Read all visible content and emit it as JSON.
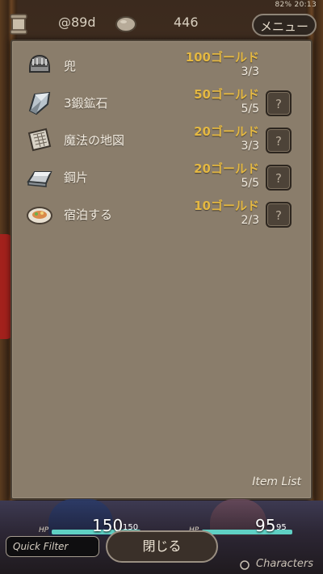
{
  "status_bar": {
    "text": "82% 20:13"
  },
  "topbar": {
    "day_label": "@89d",
    "coins": "446",
    "menu_label": "メニュー"
  },
  "items": [
    {
      "name": "兜",
      "price": "100ゴールド",
      "stock": "3/3",
      "icon": "helmet-icon",
      "has_help": false
    },
    {
      "name": "3鍛鉱石",
      "price": "50ゴールド",
      "stock": "5/5",
      "icon": "ore-icon",
      "has_help": true
    },
    {
      "name": "魔法の地図",
      "price": "20ゴールド",
      "stock": "3/3",
      "icon": "map-icon",
      "has_help": true
    },
    {
      "name": "鋼片",
      "price": "20ゴールド",
      "stock": "5/5",
      "icon": "steel-ingot-icon",
      "has_help": true
    },
    {
      "name": "宿泊する",
      "price": "10ゴールド",
      "stock": "2/3",
      "icon": "meal-plate-icon",
      "has_help": true
    }
  ],
  "help_label": "?",
  "panel_footer": "Item List",
  "hud": {
    "hp_label": "HP",
    "hp1_value": "150",
    "hp1_max": "150",
    "hp2_value": "95",
    "hp2_max": "95",
    "quick_filter_placeholder": "Quick Filter",
    "close_label": "閉じる",
    "characters_label": "Characters"
  },
  "colors": {
    "panel": "#8a7d6b",
    "price_gold": "#e4b842",
    "hp_bar": "#5fd0c4"
  }
}
